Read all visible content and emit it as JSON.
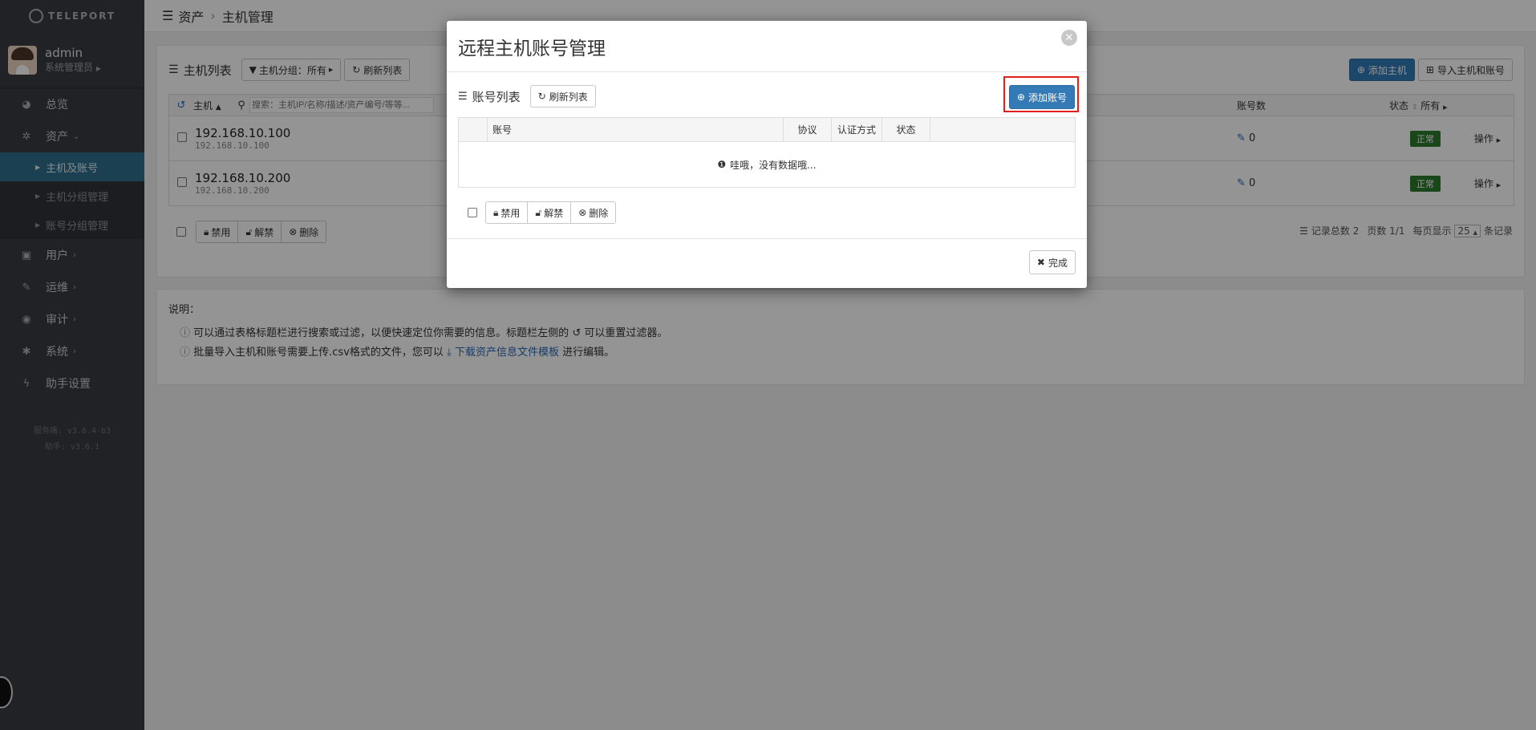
{
  "app": {
    "logo_text": "TELEPORT"
  },
  "user": {
    "name": "admin",
    "role": "系统管理员"
  },
  "sidebar": {
    "items": [
      {
        "label": "总览",
        "icon": "dashboard-icon"
      },
      {
        "label": "资产",
        "icon": "cubes-icon"
      },
      {
        "label": "用户",
        "icon": "user-card-icon"
      },
      {
        "label": "运维",
        "icon": "wrench-icon"
      },
      {
        "label": "审计",
        "icon": "eye-icon"
      },
      {
        "label": "系统",
        "icon": "gear-icon"
      },
      {
        "label": "助手设置",
        "icon": "bolt-icon"
      }
    ],
    "sub_items": [
      {
        "label": "主机及账号",
        "active": true
      },
      {
        "label": "主机分组管理",
        "active": false
      },
      {
        "label": "账号分组管理",
        "active": false
      }
    ],
    "version_server": "服务端: v3.6.4-b3",
    "version_assist": "助手: v3.6.1"
  },
  "breadcrumb": {
    "section": "资产",
    "page": "主机管理"
  },
  "host_panel": {
    "title": "主机列表",
    "group_filter": "主机分组：所有",
    "refresh": "刷新列表",
    "add_host": "添加主机",
    "import": "导入主机和账号",
    "col_host": "主机",
    "search_placeholder": "搜索：主机IP/名称/描述/资产编号/等等...",
    "col_accounts": "账号数",
    "col_status": "状态",
    "status_filter": "所有",
    "rows": [
      {
        "ip": "192.168.10.100",
        "ip_sub": "192.168.10.100",
        "accounts": "0",
        "status": "正常",
        "ops": "操作"
      },
      {
        "ip": "192.168.10.200",
        "ip_sub": "192.168.10.200",
        "accounts": "0",
        "status": "正常",
        "ops": "操作"
      }
    ],
    "disable": "禁用",
    "unlock": "解禁",
    "delete": "删除",
    "pager": {
      "total": "记录总数 2",
      "pages": "页数 1/1",
      "per_page_label": "每页显示",
      "per_page": "25",
      "suffix": "条记录"
    }
  },
  "desc": {
    "title": "说明：",
    "line1a": "可以通过表格标题栏进行搜索或过滤，以便快速定位你需要的信息。标题栏左侧的",
    "line1b": "可以重置过滤器。",
    "line2a": "批量导入主机和账号需要上传.csv格式的文件，您可以",
    "line2_link": "下载资产信息文件模板",
    "line2b": "进行编辑。"
  },
  "modal": {
    "title": "远程主机账号管理",
    "list_title": "账号列表",
    "refresh": "刷新列表",
    "add_account": "添加账号",
    "cols": [
      "账号",
      "协议",
      "认证方式",
      "状态"
    ],
    "empty": "哇哦，没有数据哦...",
    "disable": "禁用",
    "unlock": "解禁",
    "delete": "删除",
    "done": "完成"
  }
}
